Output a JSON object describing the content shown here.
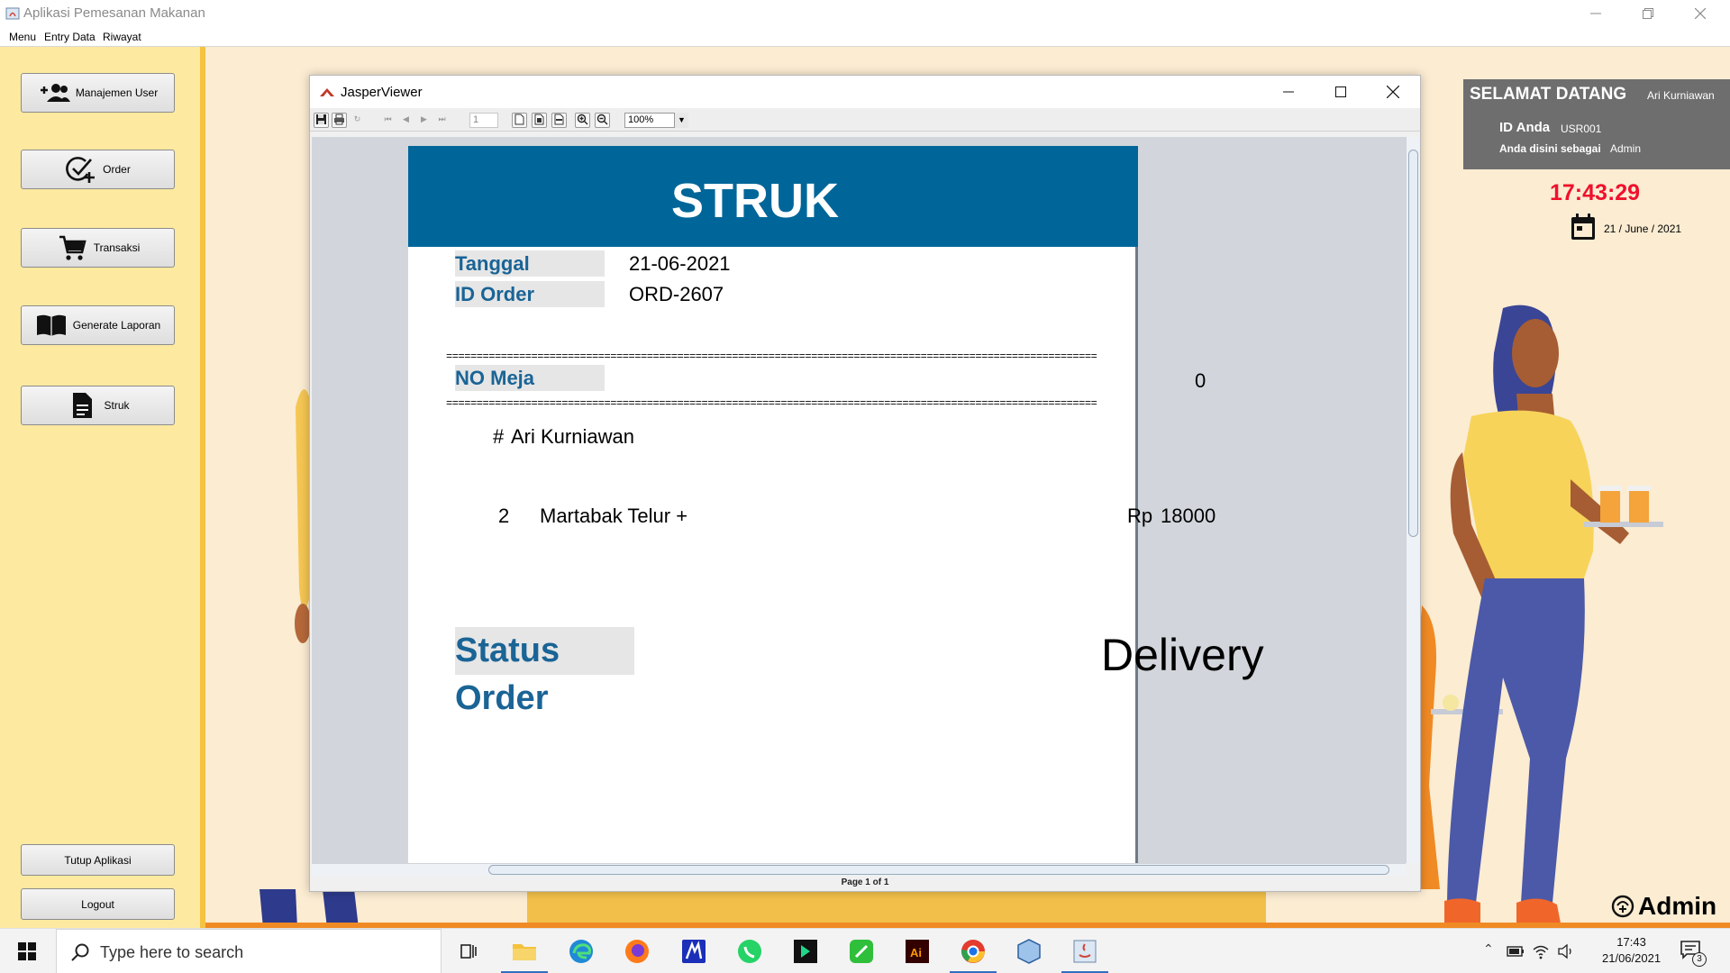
{
  "window": {
    "title": "Aplikasi Pemesanan Makanan"
  },
  "menubar": {
    "items": [
      "Menu",
      "Entry Data",
      "Riwayat"
    ]
  },
  "sidebar": {
    "buttons": [
      {
        "label": "Manajemen User",
        "icon": "add-user-icon"
      },
      {
        "label": "Order",
        "icon": "order-check-icon"
      },
      {
        "label": "Transaksi",
        "icon": "cart-icon"
      },
      {
        "label": "Generate Laporan",
        "icon": "book-icon"
      },
      {
        "label": "Struk",
        "icon": "document-icon"
      }
    ],
    "bottom_buttons": [
      {
        "label": "Tutup Aplikasi"
      },
      {
        "label": "Logout"
      }
    ]
  },
  "welcome": {
    "greeting": "SELAMAT DATANG",
    "user_name": "Ari Kurniawan",
    "id_label": "ID Anda",
    "id_value": "USR001",
    "role_label": "Anda disini sebagai",
    "role_value": "Admin"
  },
  "clock": {
    "time": "17:43:29",
    "date": "21 / June / 2021"
  },
  "admin_badge": "Admin",
  "jasper": {
    "title": "JasperViewer",
    "page_field": "1",
    "zoom": "100%",
    "status": "Page 1 of 1",
    "report": {
      "header": "STRUK",
      "tanggal_label": "Tanggal",
      "tanggal_value": "21-06-2021",
      "id_order_label": "ID Order",
      "id_order_value": "ORD-2607",
      "separator": "=========================================================================================================================================",
      "no_meja_label": "NO Meja",
      "no_meja_value": "0",
      "customer_hash": "#",
      "customer_name": "Ari Kurniawan",
      "items": [
        {
          "qty": "2",
          "name": "Martabak Telur +",
          "currency": "Rp",
          "price": "18000"
        }
      ],
      "status_label": "Status Order",
      "status_value": "Delivery"
    }
  },
  "taskbar": {
    "search_placeholder": "Type here to search",
    "time": "17:43",
    "date": "21/06/2021",
    "notifications": "3"
  },
  "colors": {
    "report_header": "#006699",
    "label_text": "#1a6496",
    "clock": "#f0102c",
    "sidebar": "#fde9a0",
    "background": "#fbecd2"
  }
}
